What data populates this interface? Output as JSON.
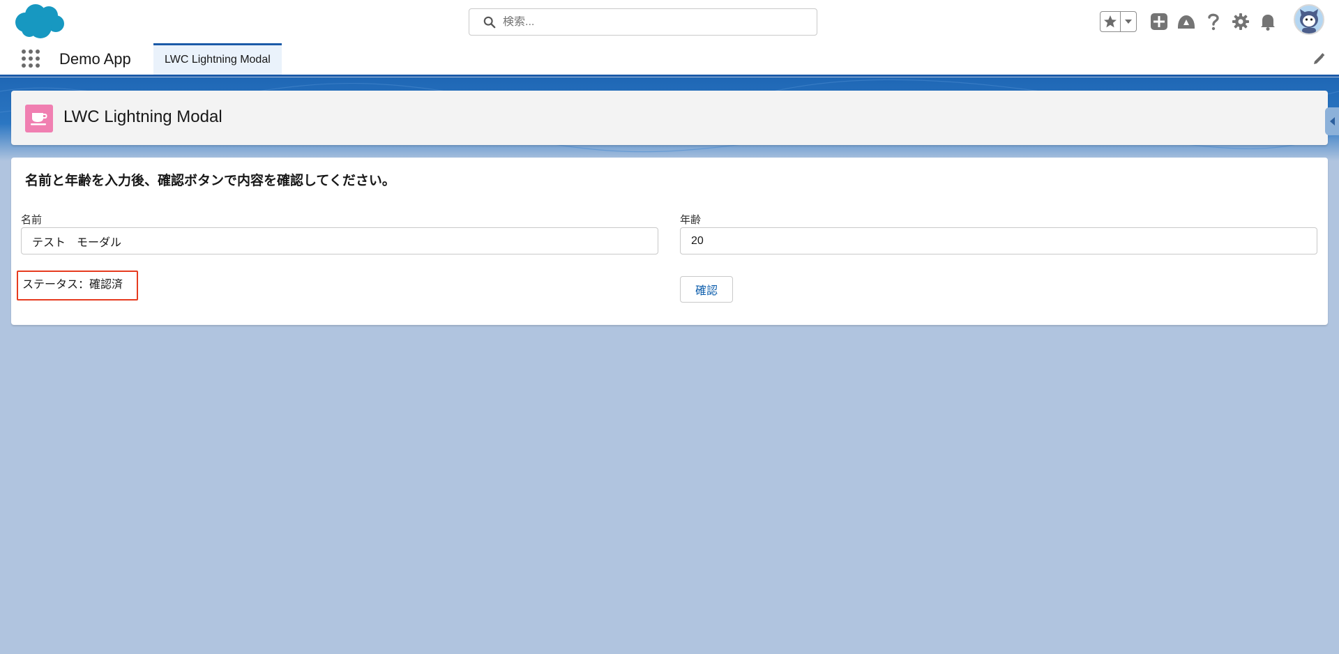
{
  "header": {
    "search_placeholder": "検索..."
  },
  "nav": {
    "app_name": "Demo App",
    "active_tab": "LWC Lightning Modal"
  },
  "page_header": {
    "title": "LWC Lightning Modal"
  },
  "form": {
    "instructions": "名前と年齢を入力後、確認ボタンで内容を確認してください。",
    "name_label": "名前",
    "name_value": "テスト　モーダル",
    "age_label": "年齢",
    "age_value": "20",
    "status_text": "ステータス：確認済",
    "confirm_label": "確認"
  },
  "colors": {
    "brand_blue": "#1b5aa8",
    "salesforce_cloud": "#1798c1",
    "page_icon": "#f07fb1",
    "status_highlight": "#e63b1f"
  }
}
